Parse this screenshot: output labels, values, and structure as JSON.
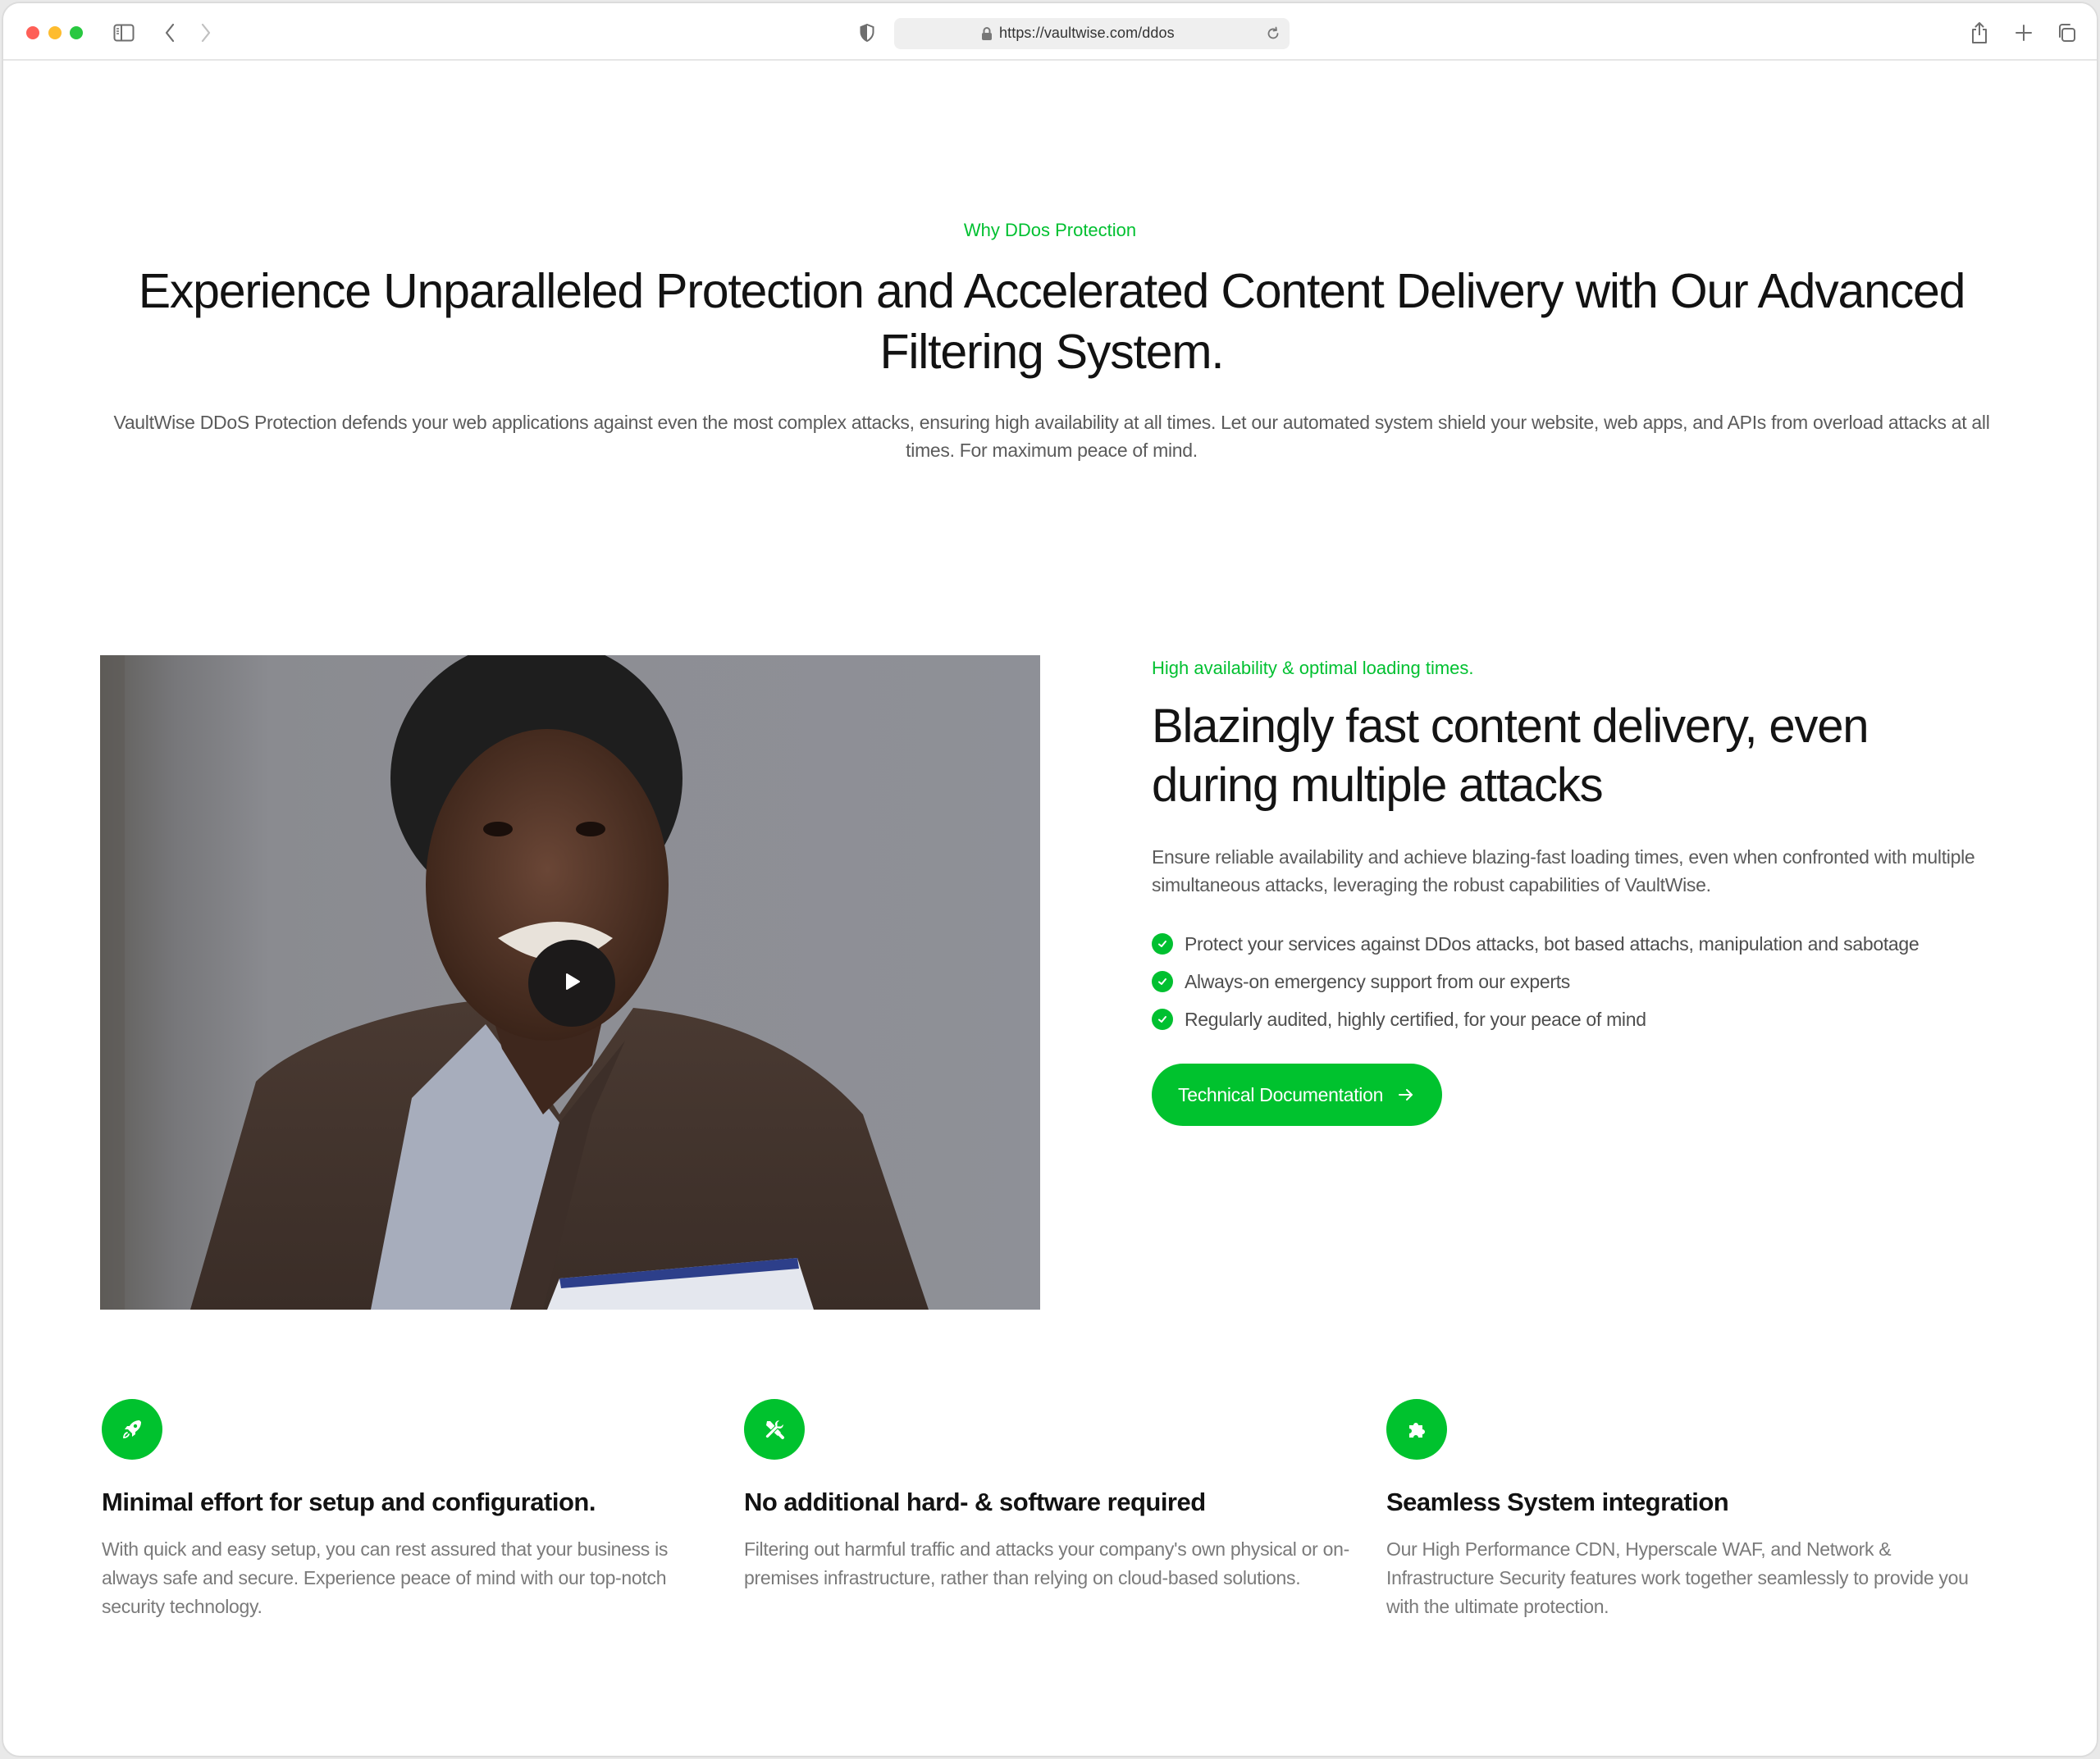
{
  "browser": {
    "url": "https://vaultwise.com/ddos",
    "icons": {
      "sidebar": "sidebar-toggle-icon",
      "back": "chevron-left-icon",
      "forward": "chevron-right-icon",
      "privacy": "shield-icon",
      "lock": "lock-icon",
      "reload": "reload-icon",
      "share": "share-icon",
      "new_tab": "plus-icon",
      "tab_overview": "tabs-icon"
    }
  },
  "intro": {
    "eyebrow": "Why DDos Protection",
    "title": "Experience Unparalleled Protection and Accelerated Content Delivery with Our Advanced Filtering System.",
    "description": "VaultWise DDoS Protection defends your web applications against even the most complex attacks, ensuring high availability at all times. Let our automated system shield your website, web apps, and APIs from overload attacks at all times. For maximum peace of mind."
  },
  "media": {
    "image_alt": "Smiling woman in a brown blazer holding a magazine",
    "play_icon": "play-icon"
  },
  "feature": {
    "eyebrow": "High availability & optimal loading times.",
    "title": "Blazingly fast content delivery, even during multiple attacks",
    "description": "Ensure reliable availability and achieve blazing-fast loading times, even when confronted with multiple simultaneous attacks, leveraging the robust capabilities of VaultWise.",
    "checklist": [
      "Protect your services against DDos attacks, bot based attachs, manipulation and sabotage",
      "Always-on emergency support from our experts",
      "Regularly audited, highly certified, for your peace of mind"
    ],
    "button_label": "Technical Documentation",
    "button_icon": "arrow-right-icon"
  },
  "cards": [
    {
      "icon": "rocket-icon",
      "title": "Minimal effort for setup and configuration.",
      "description": "With quick and easy setup, you can rest assured that your business is always safe and secure. Experience peace of mind with our top-notch security technology."
    },
    {
      "icon": "tools-icon",
      "title": "No additional hard- & software required",
      "description": "Filtering out harmful traffic and attacks your company's own physical or on-premises infrastructure, rather than relying on cloud-based solutions."
    },
    {
      "icon": "puzzle-icon",
      "title": "Seamless System integration",
      "description": "Our High Performance CDN, Hyperscale WAF, and Network & Infrastructure Security features work together seamlessly to provide you with the ultimate protection."
    }
  ],
  "colors": {
    "accent": "#00c22e",
    "heading": "#121212",
    "body_text": "#5b5b5b",
    "muted_text": "#7a7a7a"
  }
}
